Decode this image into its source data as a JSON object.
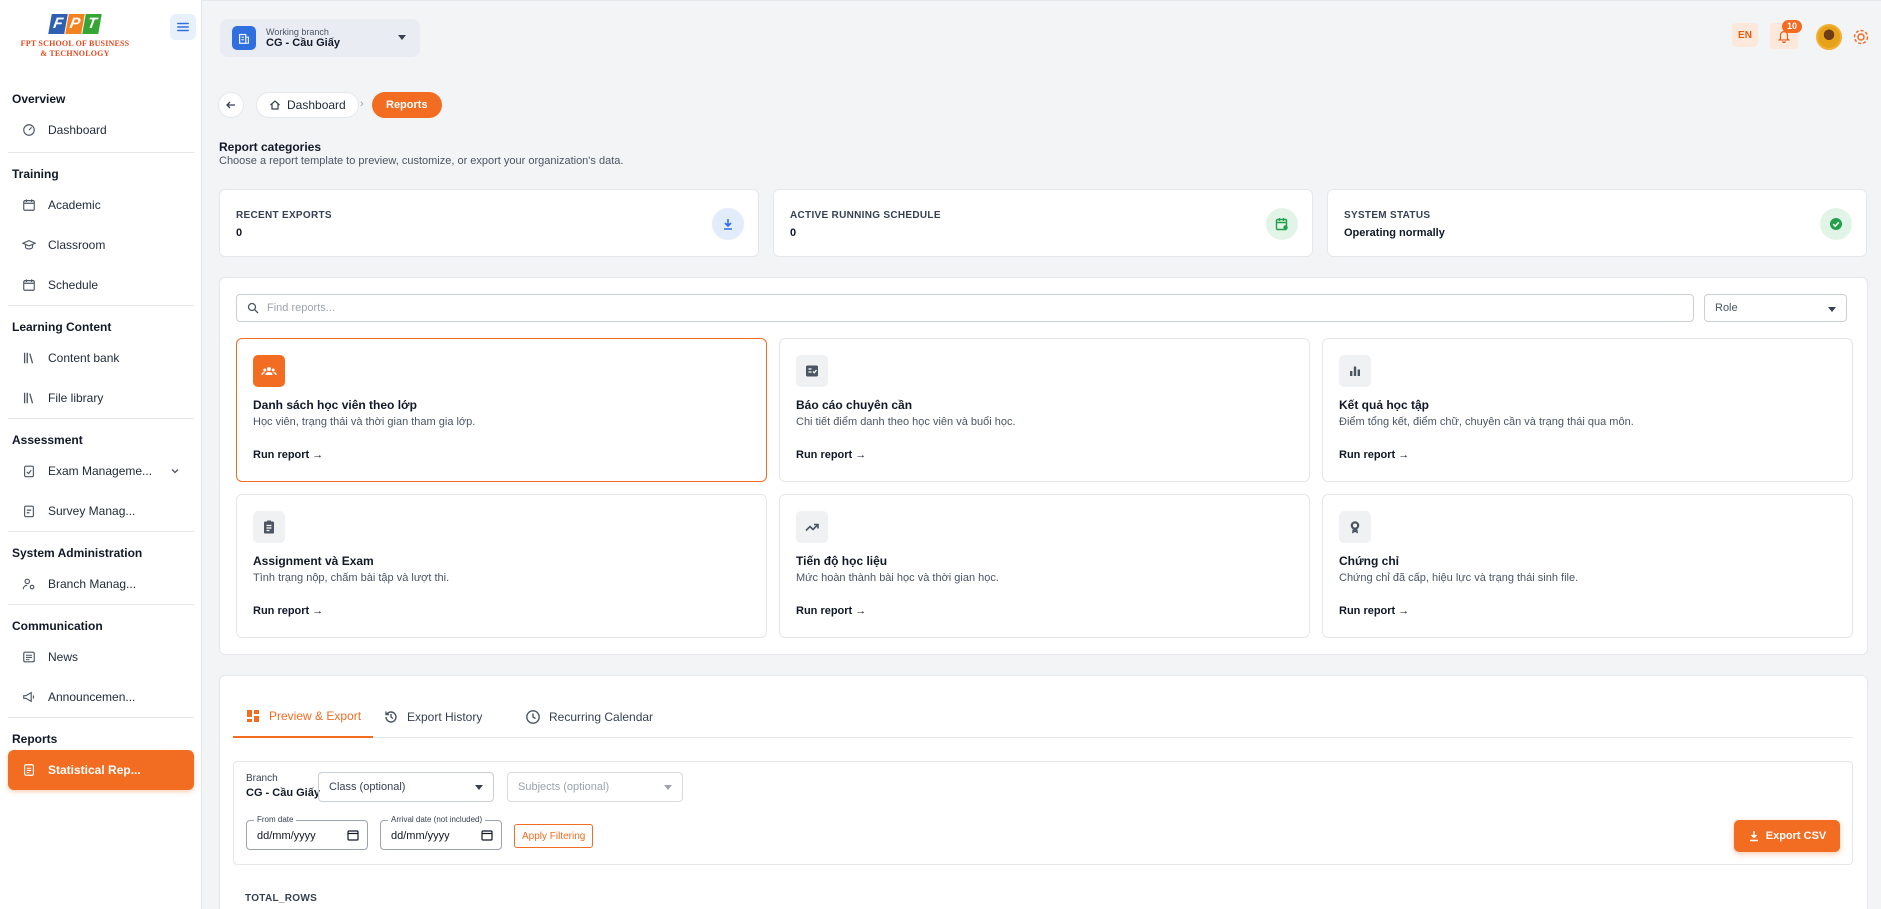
{
  "sidebar": {
    "logo_text_line1": "FPT SCHOOL OF BUSINESS",
    "logo_text_line2": "& TECHNOLOGY",
    "logo_letters": [
      "F",
      "P",
      "T"
    ],
    "sections": [
      {
        "title": "Overview",
        "items": [
          {
            "label": "Dashboard",
            "icon": "gauge-icon"
          }
        ]
      },
      {
        "title": "Training",
        "items": [
          {
            "label": "Academic",
            "icon": "calendar-gear-icon"
          },
          {
            "label": "Classroom",
            "icon": "graduation-cap-icon"
          },
          {
            "label": "Schedule",
            "icon": "calendar-icon"
          }
        ]
      },
      {
        "title": "Learning Content",
        "items": [
          {
            "label": "Content bank",
            "icon": "library-icon"
          },
          {
            "label": "File library",
            "icon": "library-icon"
          }
        ]
      },
      {
        "title": "Assessment",
        "items": [
          {
            "label": "Exam Manageme...",
            "icon": "clipboard-check-icon"
          },
          {
            "label": "Survey Manag...",
            "icon": "clipboard-list-icon"
          }
        ]
      },
      {
        "title": "System Administration",
        "items": [
          {
            "label": "Branch Manag...",
            "icon": "user-gear-icon"
          }
        ]
      },
      {
        "title": "Communication",
        "items": [
          {
            "label": "News",
            "icon": "newspaper-icon"
          },
          {
            "label": "Announcemen...",
            "icon": "megaphone-icon"
          }
        ]
      },
      {
        "title": "Reports",
        "items": [
          {
            "label": "Statistical Rep...",
            "icon": "report-icon"
          }
        ]
      }
    ]
  },
  "topbar": {
    "branch_caption": "Working branch",
    "branch_name": "CG - Cầu Giấy",
    "language": "EN",
    "notification_count": "10"
  },
  "breadcrumb": {
    "home": "Dashboard",
    "current": "Reports"
  },
  "header": {
    "title": "Report categories",
    "subtitle": "Choose a report template to preview, customize, or export your organization's data."
  },
  "stats": [
    {
      "label": "RECENT EXPORTS",
      "value": "0",
      "icon": "download-icon",
      "color": "#2f6fe0"
    },
    {
      "label": "ACTIVE RUNNING SCHEDULE",
      "value": "0",
      "icon": "calendar-refresh-icon",
      "color": "#22a04b"
    },
    {
      "label": "SYSTEM STATUS",
      "value": "Operating normally",
      "icon": "check-circle-icon",
      "color": "#22a04b"
    }
  ],
  "search": {
    "placeholder": "Find reports...",
    "role_label": "Role"
  },
  "reports": [
    {
      "title": "Danh sách học viên theo lớp",
      "desc": "Học viên, trạng thái và thời gian tham gia lớp.",
      "run": "Run report →",
      "icon": "users-icon",
      "selected": true
    },
    {
      "title": "Báo cáo chuyên cần",
      "desc": "Chi tiết điểm danh theo học viên và buổi học.",
      "run": "Run report →",
      "icon": "checklist-icon",
      "selected": false
    },
    {
      "title": "Kết quả học tập",
      "desc": "Điểm tổng kết, điểm chữ, chuyên cần và trạng thái qua môn.",
      "run": "Run report →",
      "icon": "bar-chart-icon",
      "selected": false
    },
    {
      "title": "Assignment và Exam",
      "desc": "Tình trạng nộp, chấm bài tập và lượt thi.",
      "run": "Run report →",
      "icon": "assignment-icon",
      "selected": false
    },
    {
      "title": "Tiến độ học liệu",
      "desc": "Mức hoàn thành bài học và thời gian học.",
      "run": "Run report →",
      "icon": "trending-up-icon",
      "selected": false
    },
    {
      "title": "Chứng chỉ",
      "desc": "Chứng chỉ đã cấp, hiệu lực và trạng thái sinh file.",
      "run": "Run report →",
      "icon": "award-icon",
      "selected": false
    }
  ],
  "tabs": [
    {
      "label": "Preview & Export",
      "icon": "dashboard-icon",
      "active": true
    },
    {
      "label": "Export History",
      "icon": "history-icon",
      "active": false
    },
    {
      "label": "Recurring Calendar",
      "icon": "clock-icon",
      "active": false
    }
  ],
  "filters": {
    "branch_label": "Branch",
    "branch_value": "CG - Cầu Giấy",
    "class_placeholder": "Class (optional)",
    "subjects_placeholder": "Subjects (optional)",
    "from_label": "From date",
    "from_value": "dd/mm/yyyy",
    "to_label": "Arrival date (not included)",
    "to_value": "dd/mm/yyyy",
    "apply_label": "Apply Filtering",
    "export_label": "Export CSV"
  },
  "results": {
    "total_rows_label": "TOTAL_ROWS"
  },
  "colors": {
    "accent": "#f26c21",
    "primary_blue": "#2f6fe0",
    "success": "#22a04b"
  }
}
